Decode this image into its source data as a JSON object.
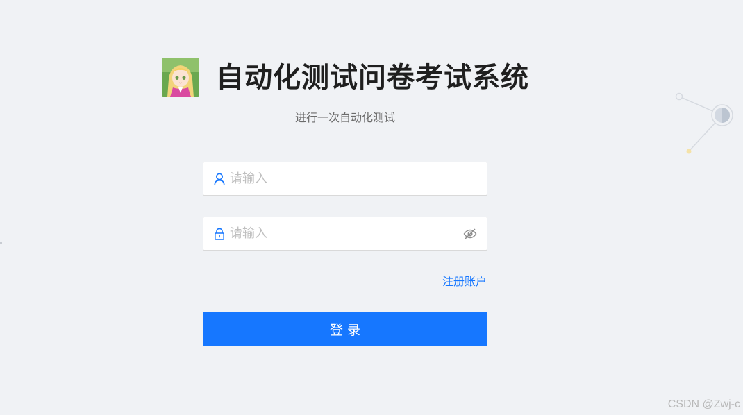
{
  "header": {
    "title": "自动化测试问卷考试系统",
    "subtitle": "进行一次自动化测试"
  },
  "form": {
    "username": {
      "placeholder": "请输入",
      "value": "",
      "prefix_icon": "user-icon"
    },
    "password": {
      "placeholder": "请输入",
      "value": "",
      "prefix_icon": "lock-icon",
      "suffix_icon": "eye-invisible-icon"
    },
    "register_link": "注册账户",
    "login_button": "登录"
  },
  "watermark": "CSDN @Zwj-c",
  "colors": {
    "accent": "#1677ff",
    "background": "#f0f2f5"
  }
}
